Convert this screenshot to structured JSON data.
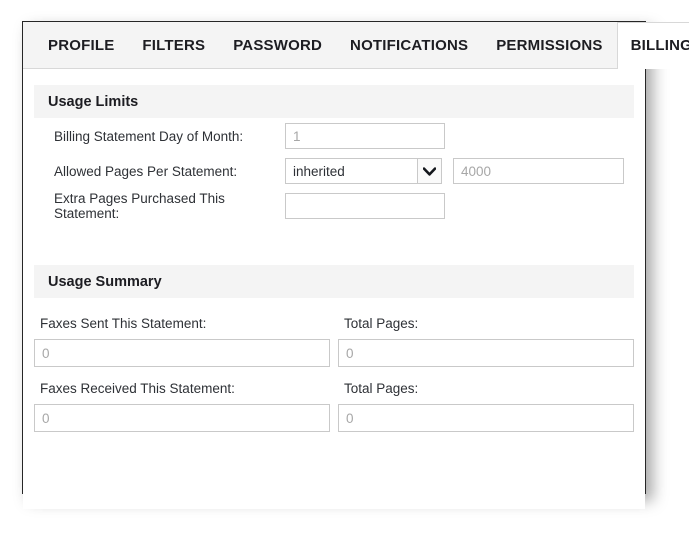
{
  "tabs": [
    {
      "label": "PROFILE",
      "active": false
    },
    {
      "label": "FILTERS",
      "active": false
    },
    {
      "label": "PASSWORD",
      "active": false
    },
    {
      "label": "NOTIFICATIONS",
      "active": false
    },
    {
      "label": "PERMISSIONS",
      "active": false
    },
    {
      "label": "BILLING",
      "active": true
    }
  ],
  "usage_limits": {
    "heading": "Usage Limits",
    "billing_day": {
      "label": "Billing Statement Day of Month:",
      "value": "",
      "placeholder": "1"
    },
    "allowed_pages": {
      "label": "Allowed Pages Per Statement:",
      "selected": "inherited",
      "options": [
        "inherited"
      ],
      "arrow_icon": "chevron-down-icon",
      "inherited_value": "",
      "inherited_placeholder": "4000"
    },
    "extra_pages": {
      "label": "Extra Pages Purchased This Statement:",
      "value": "",
      "placeholder": ""
    }
  },
  "usage_summary": {
    "heading": "Usage Summary",
    "faxes_sent": {
      "label": "Faxes Sent This Statement:",
      "value": "",
      "placeholder": "0"
    },
    "faxes_sent_pages": {
      "label": "Total Pages:",
      "value": "",
      "placeholder": "0"
    },
    "faxes_received": {
      "label": "Faxes Received This Statement:",
      "value": "",
      "placeholder": "0"
    },
    "faxes_received_pages": {
      "label": "Total Pages:",
      "value": "",
      "placeholder": "0"
    }
  },
  "colors": {
    "panel_border": "#262626",
    "tabbar_bg": "#f4f4f4",
    "section_bg": "#f4f4f4",
    "text": "#2e3136",
    "placeholder": "#a7a7a7",
    "input_border": "#c9c9c9"
  }
}
